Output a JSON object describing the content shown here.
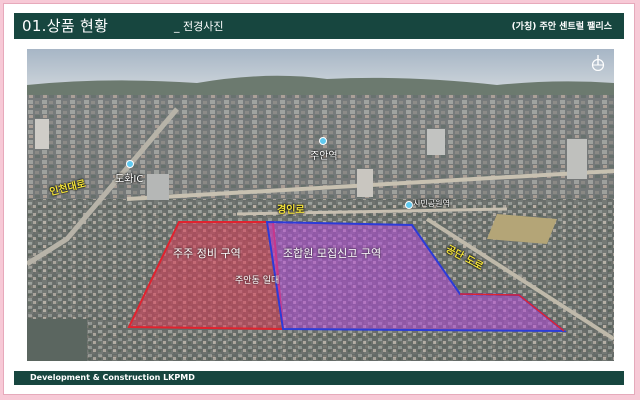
{
  "header": {
    "title": "01.상품 현황",
    "subtitle": "_ 전경사진",
    "project": "(가칭) 주안 센트럴 팰리스"
  },
  "photo": {
    "labels": {
      "road_west": "인천대로",
      "dohwa_ic": "도화IC",
      "juan_station": "주안역",
      "city_hall_park": "시민공원역",
      "main_road": "경인로",
      "right_road": "공단 도로",
      "zone_red": "주주 정비 구역",
      "zone_purple": "조합원 모집신고 구역",
      "zone_center": "주안동 일대"
    },
    "icons": [
      "compass-icon",
      "location-dot-icon"
    ],
    "colors": {
      "red_zone": "#e0232f",
      "purple_zone": "#b249d8",
      "blue_border": "#2c3cd8",
      "dot": "#5fc9f0",
      "label": "#f2e23a"
    }
  },
  "footer": {
    "text": "Development & Construction LKPMD"
  }
}
